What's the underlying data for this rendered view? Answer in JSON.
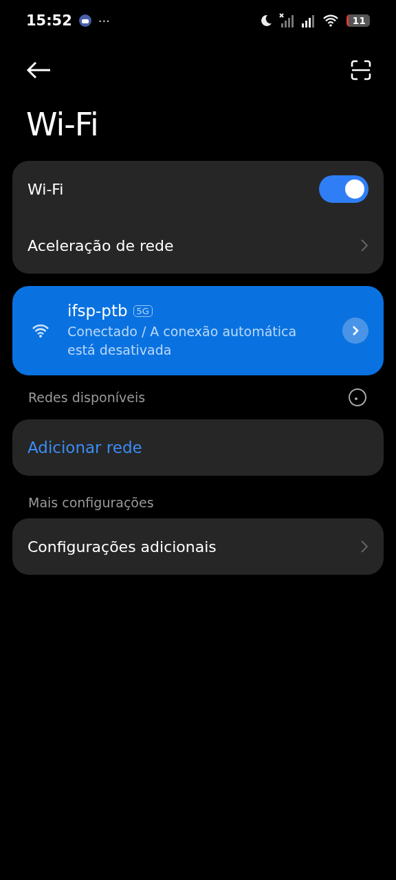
{
  "status_bar": {
    "time": "15:52",
    "more": "···",
    "battery": "11"
  },
  "title": "Wi-Fi",
  "main_card": {
    "items": [
      {
        "kind": "toggle",
        "label": "Wi-Fi",
        "on": true
      },
      {
        "kind": "link",
        "label": "Aceleração de rede"
      }
    ]
  },
  "connected_network": {
    "name": "ifsp-ptb",
    "band": "5G",
    "status": "Conectado / A conexão automática está desativada"
  },
  "available_section": {
    "label": "Redes disponíveis"
  },
  "add_network": {
    "label": "Adicionar rede"
  },
  "more_section": {
    "label": "Mais configurações",
    "items": [
      {
        "kind": "link",
        "label": "Configurações adicionais"
      }
    ]
  }
}
